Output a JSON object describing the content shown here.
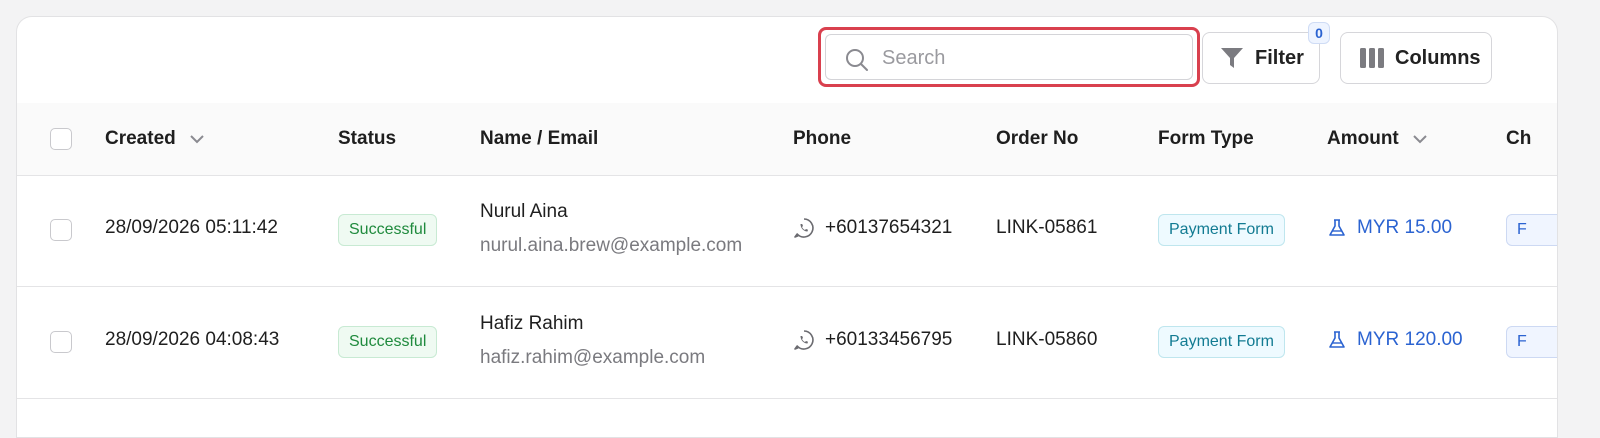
{
  "toolbar": {
    "search_placeholder": "Search",
    "filter_label": "Filter",
    "filter_count": "0",
    "columns_label": "Columns"
  },
  "table": {
    "columns": {
      "created": "Created",
      "status": "Status",
      "name_email": "Name / Email",
      "phone": "Phone",
      "order_no": "Order No",
      "form_type": "Form Type",
      "amount": "Amount",
      "partial_next": "Ch"
    },
    "rows": [
      {
        "created": "28/09/2026 05:11:42",
        "status": "Successful",
        "name": "Nurul Aina",
        "email": "nurul.aina.brew@example.com",
        "phone": "+60137654321",
        "order_no": "LINK-05861",
        "form_type": "Payment Form",
        "amount": "MYR 15.00",
        "partial_next": "F"
      },
      {
        "created": "28/09/2026 04:08:43",
        "status": "Successful",
        "name": "Hafiz Rahim",
        "email": "hafiz.rahim@example.com",
        "phone": "+60133456795",
        "order_no": "LINK-05860",
        "form_type": "Payment Form",
        "amount": "MYR 120.00",
        "partial_next": "F"
      }
    ]
  },
  "colors": {
    "focus_ring": "#d9404e",
    "success": "#1f8a3d",
    "link": "#2b63d1",
    "form_type": "#127b92"
  },
  "icons": {
    "search": "search-icon",
    "filter": "funnel-icon",
    "columns": "columns-icon",
    "sort": "chevron-down-icon",
    "phone": "whatsapp-icon",
    "amount": "flask-icon"
  }
}
